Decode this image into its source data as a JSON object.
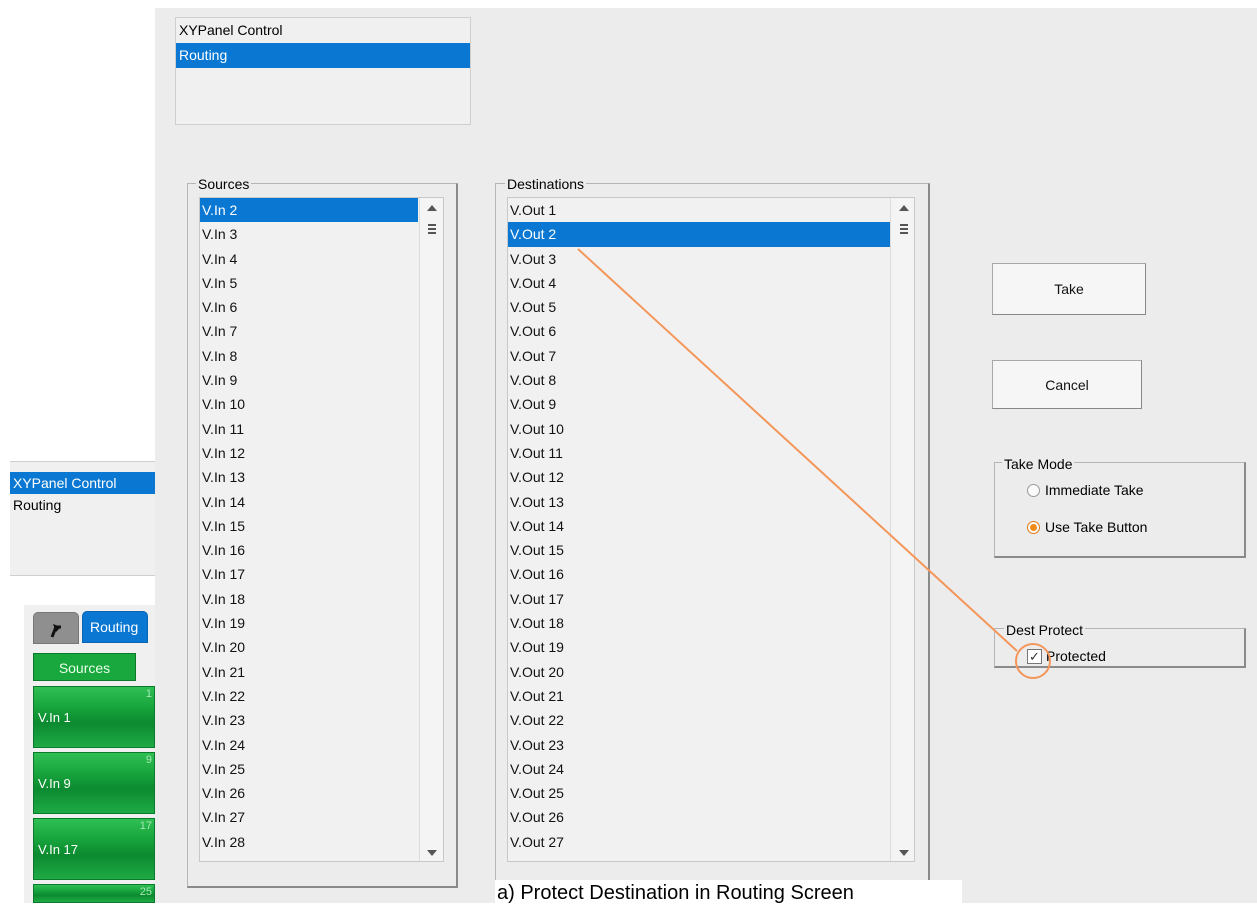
{
  "top_mode_list": {
    "items": [
      "XYPanel Control",
      "Routing"
    ],
    "selected_index": 1
  },
  "sources": {
    "title": "Sources",
    "items": [
      "V.In 2",
      "V.In 3",
      "V.In 4",
      "V.In 5",
      "V.In 6",
      "V.In 7",
      "V.In 8",
      "V.In 9",
      "V.In 10",
      "V.In 11",
      "V.In 12",
      "V.In 13",
      "V.In 14",
      "V.In 15",
      "V.In 16",
      "V.In 17",
      "V.In 18",
      "V.In 19",
      "V.In 20",
      "V.In 21",
      "V.In 22",
      "V.In 23",
      "V.In 24",
      "V.In 25",
      "V.In 26",
      "V.In 27",
      "V.In 28"
    ],
    "selected_index": 0
  },
  "destinations": {
    "title": "Destinations",
    "items": [
      "V.Out 1",
      "V.Out 2",
      "V.Out 3",
      "V.Out 4",
      "V.Out 5",
      "V.Out 6",
      "V.Out 7",
      "V.Out 8",
      "V.Out 9",
      "V.Out 10",
      "V.Out 11",
      "V.Out 12",
      "V.Out 13",
      "V.Out 14",
      "V.Out 15",
      "V.Out 16",
      "V.Out 17",
      "V.Out 18",
      "V.Out 19",
      "V.Out 20",
      "V.Out 21",
      "V.Out 22",
      "V.Out 23",
      "V.Out 24",
      "V.Out 25",
      "V.Out 26",
      "V.Out 27"
    ],
    "selected_index": 1
  },
  "buttons": {
    "take": "Take",
    "cancel": "Cancel"
  },
  "take_mode": {
    "title": "Take Mode",
    "immediate": "Immediate Take",
    "use_button": "Use Take Button",
    "selected": "use_button"
  },
  "dest_protect": {
    "title": "Dest Protect",
    "protected_label": "Protected",
    "checked": true
  },
  "inset": {
    "mode_list": [
      "XYPanel Control",
      "Routing"
    ],
    "mode_selected_index": 0,
    "tab_label": "Routing",
    "sources_button": "Sources",
    "tiles": [
      {
        "label": "V.In 1",
        "num": "1"
      },
      {
        "label": "V.In 9",
        "num": "9"
      },
      {
        "label": "V.In 17",
        "num": "17"
      },
      {
        "label": "",
        "num": "25"
      }
    ]
  },
  "annotation": {
    "color": "#f4965a"
  },
  "caption": "a) Protect Destination in Routing Screen"
}
